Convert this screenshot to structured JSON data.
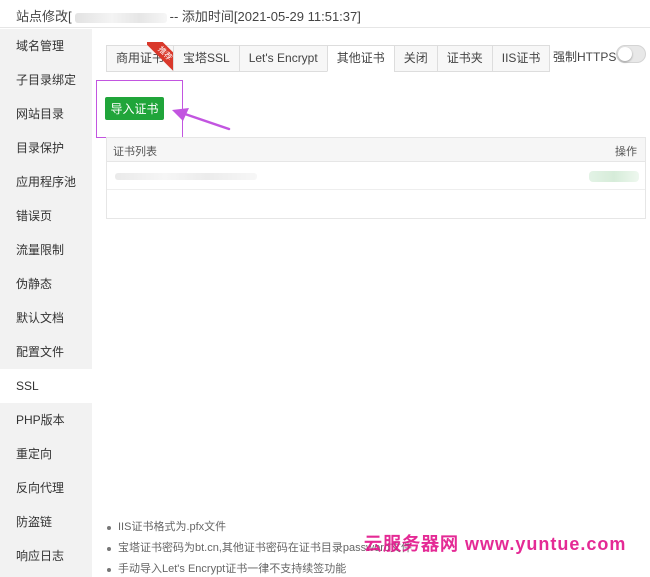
{
  "window": {
    "title_prefix": "站点修改[",
    "title_suffix": "-- 添加时间[2021-05-29 11:51:37]"
  },
  "sidebar": {
    "items": [
      {
        "label": "域名管理"
      },
      {
        "label": "子目录绑定"
      },
      {
        "label": "网站目录"
      },
      {
        "label": "目录保护"
      },
      {
        "label": "应用程序池"
      },
      {
        "label": "错误页"
      },
      {
        "label": "流量限制"
      },
      {
        "label": "伪静态"
      },
      {
        "label": "默认文档"
      },
      {
        "label": "配置文件"
      },
      {
        "label": "SSL"
      },
      {
        "label": "PHP版本"
      },
      {
        "label": "重定向"
      },
      {
        "label": "反向代理"
      },
      {
        "label": "防盗链"
      },
      {
        "label": "响应日志"
      }
    ],
    "active": "SSL"
  },
  "tabs": [
    {
      "label": "商用证书",
      "badge": "推荐"
    },
    {
      "label": "宝塔SSL"
    },
    {
      "label": "Let's Encrypt"
    },
    {
      "label": "其他证书"
    },
    {
      "label": "关闭"
    },
    {
      "label": "证书夹"
    },
    {
      "label": "IIS证书"
    }
  ],
  "active_tab": "其他证书",
  "force_https": {
    "label": "强制HTTPS",
    "enabled": false
  },
  "import_button": {
    "label": "导入证书"
  },
  "cert_table": {
    "headers": [
      "证书列表",
      "操作"
    ]
  },
  "notes": [
    "IIS证书格式为.pfx文件",
    "宝塔证书密码为bt.cn,其他证书密码在证书目录password文件",
    "手动导入Let's Encrypt证书一律不支持续签功能"
  ],
  "watermark": "云服务器网 www.yuntue.com",
  "colors": {
    "primary_green": "#20a53a",
    "highlight_purple": "#c255e0",
    "badge_red": "#d9382b",
    "watermark_pink": "#e2148a"
  }
}
